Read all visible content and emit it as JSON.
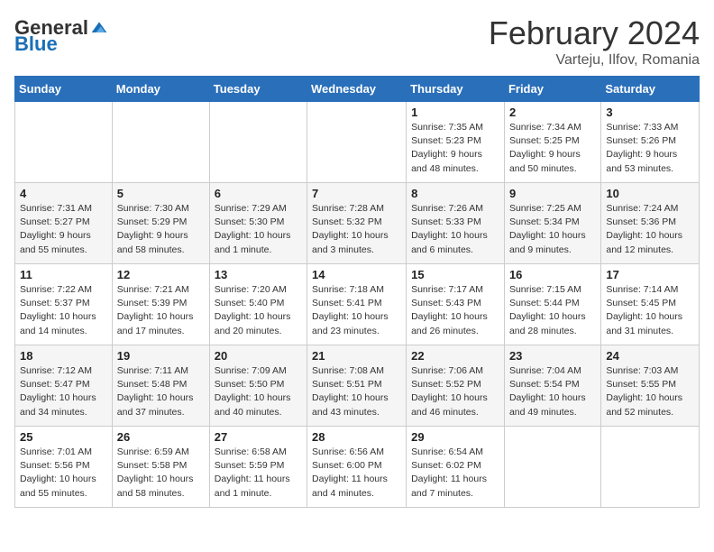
{
  "header": {
    "logo_general": "General",
    "logo_blue": "Blue",
    "month_title": "February 2024",
    "location": "Varteju, Ilfov, Romania"
  },
  "weekdays": [
    "Sunday",
    "Monday",
    "Tuesday",
    "Wednesday",
    "Thursday",
    "Friday",
    "Saturday"
  ],
  "rows": [
    [
      {
        "day": "",
        "info": ""
      },
      {
        "day": "",
        "info": ""
      },
      {
        "day": "",
        "info": ""
      },
      {
        "day": "",
        "info": ""
      },
      {
        "day": "1",
        "info": "Sunrise: 7:35 AM\nSunset: 5:23 PM\nDaylight: 9 hours\nand 48 minutes."
      },
      {
        "day": "2",
        "info": "Sunrise: 7:34 AM\nSunset: 5:25 PM\nDaylight: 9 hours\nand 50 minutes."
      },
      {
        "day": "3",
        "info": "Sunrise: 7:33 AM\nSunset: 5:26 PM\nDaylight: 9 hours\nand 53 minutes."
      }
    ],
    [
      {
        "day": "4",
        "info": "Sunrise: 7:31 AM\nSunset: 5:27 PM\nDaylight: 9 hours\nand 55 minutes."
      },
      {
        "day": "5",
        "info": "Sunrise: 7:30 AM\nSunset: 5:29 PM\nDaylight: 9 hours\nand 58 minutes."
      },
      {
        "day": "6",
        "info": "Sunrise: 7:29 AM\nSunset: 5:30 PM\nDaylight: 10 hours\nand 1 minute."
      },
      {
        "day": "7",
        "info": "Sunrise: 7:28 AM\nSunset: 5:32 PM\nDaylight: 10 hours\nand 3 minutes."
      },
      {
        "day": "8",
        "info": "Sunrise: 7:26 AM\nSunset: 5:33 PM\nDaylight: 10 hours\nand 6 minutes."
      },
      {
        "day": "9",
        "info": "Sunrise: 7:25 AM\nSunset: 5:34 PM\nDaylight: 10 hours\nand 9 minutes."
      },
      {
        "day": "10",
        "info": "Sunrise: 7:24 AM\nSunset: 5:36 PM\nDaylight: 10 hours\nand 12 minutes."
      }
    ],
    [
      {
        "day": "11",
        "info": "Sunrise: 7:22 AM\nSunset: 5:37 PM\nDaylight: 10 hours\nand 14 minutes."
      },
      {
        "day": "12",
        "info": "Sunrise: 7:21 AM\nSunset: 5:39 PM\nDaylight: 10 hours\nand 17 minutes."
      },
      {
        "day": "13",
        "info": "Sunrise: 7:20 AM\nSunset: 5:40 PM\nDaylight: 10 hours\nand 20 minutes."
      },
      {
        "day": "14",
        "info": "Sunrise: 7:18 AM\nSunset: 5:41 PM\nDaylight: 10 hours\nand 23 minutes."
      },
      {
        "day": "15",
        "info": "Sunrise: 7:17 AM\nSunset: 5:43 PM\nDaylight: 10 hours\nand 26 minutes."
      },
      {
        "day": "16",
        "info": "Sunrise: 7:15 AM\nSunset: 5:44 PM\nDaylight: 10 hours\nand 28 minutes."
      },
      {
        "day": "17",
        "info": "Sunrise: 7:14 AM\nSunset: 5:45 PM\nDaylight: 10 hours\nand 31 minutes."
      }
    ],
    [
      {
        "day": "18",
        "info": "Sunrise: 7:12 AM\nSunset: 5:47 PM\nDaylight: 10 hours\nand 34 minutes."
      },
      {
        "day": "19",
        "info": "Sunrise: 7:11 AM\nSunset: 5:48 PM\nDaylight: 10 hours\nand 37 minutes."
      },
      {
        "day": "20",
        "info": "Sunrise: 7:09 AM\nSunset: 5:50 PM\nDaylight: 10 hours\nand 40 minutes."
      },
      {
        "day": "21",
        "info": "Sunrise: 7:08 AM\nSunset: 5:51 PM\nDaylight: 10 hours\nand 43 minutes."
      },
      {
        "day": "22",
        "info": "Sunrise: 7:06 AM\nSunset: 5:52 PM\nDaylight: 10 hours\nand 46 minutes."
      },
      {
        "day": "23",
        "info": "Sunrise: 7:04 AM\nSunset: 5:54 PM\nDaylight: 10 hours\nand 49 minutes."
      },
      {
        "day": "24",
        "info": "Sunrise: 7:03 AM\nSunset: 5:55 PM\nDaylight: 10 hours\nand 52 minutes."
      }
    ],
    [
      {
        "day": "25",
        "info": "Sunrise: 7:01 AM\nSunset: 5:56 PM\nDaylight: 10 hours\nand 55 minutes."
      },
      {
        "day": "26",
        "info": "Sunrise: 6:59 AM\nSunset: 5:58 PM\nDaylight: 10 hours\nand 58 minutes."
      },
      {
        "day": "27",
        "info": "Sunrise: 6:58 AM\nSunset: 5:59 PM\nDaylight: 11 hours\nand 1 minute."
      },
      {
        "day": "28",
        "info": "Sunrise: 6:56 AM\nSunset: 6:00 PM\nDaylight: 11 hours\nand 4 minutes."
      },
      {
        "day": "29",
        "info": "Sunrise: 6:54 AM\nSunset: 6:02 PM\nDaylight: 11 hours\nand 7 minutes."
      },
      {
        "day": "",
        "info": ""
      },
      {
        "day": "",
        "info": ""
      }
    ]
  ]
}
